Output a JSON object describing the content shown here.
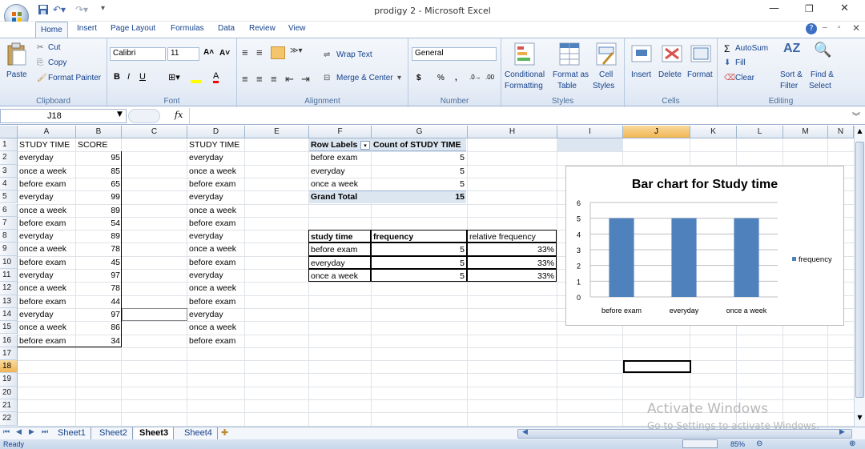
{
  "window": {
    "title": "prodigy 2 - Microsoft Excel"
  },
  "tabs": [
    "Home",
    "Insert",
    "Page Layout",
    "Formulas",
    "Data",
    "Review",
    "View"
  ],
  "ribbon": {
    "clipboard": {
      "paste": "Paste",
      "cut": "Cut",
      "copy": "Copy",
      "format_painter": "Format Painter",
      "label": "Clipboard"
    },
    "font": {
      "name": "Calibri",
      "size": "11",
      "label": "Font"
    },
    "alignment": {
      "wrap": "Wrap Text",
      "merge": "Merge & Center",
      "label": "Alignment"
    },
    "number": {
      "format": "General",
      "dollar": "$",
      "percent": "%",
      "comma": ",",
      "label": "Number"
    },
    "styles": {
      "conditional_1": "Conditional",
      "conditional_2": "Formatting",
      "format_table_1": "Format as",
      "format_table_2": "Table",
      "cell_styles_1": "Cell",
      "cell_styles_2": "Styles",
      "label": "Styles"
    },
    "cells": {
      "insert": "Insert",
      "delete": "Delete",
      "format": "Format",
      "label": "Cells"
    },
    "editing": {
      "autosum": "AutoSum",
      "fill": "Fill",
      "clear": "Clear",
      "sort_1": "Sort &",
      "sort_2": "Filter",
      "find_1": "Find &",
      "find_2": "Select",
      "label": "Editing"
    }
  },
  "formula_bar": {
    "cell_ref": "J18",
    "fx": "fx",
    "value": ""
  },
  "columns": [
    "A",
    "B",
    "C",
    "D",
    "E",
    "F",
    "G",
    "H",
    "I",
    "J",
    "K",
    "L",
    "M",
    "N"
  ],
  "rows": [
    "1",
    "2",
    "3",
    "4",
    "5",
    "6",
    "7",
    "8",
    "9",
    "10",
    "11",
    "12",
    "13",
    "14",
    "15",
    "16",
    "17",
    "18",
    "19",
    "20",
    "21",
    "22"
  ],
  "colA": [
    "STUDY TIME",
    "everyday",
    "once a week",
    "before exam",
    "everyday",
    "once a week",
    "before exam",
    "everyday",
    "once a week",
    "before exam",
    "everyday",
    "once a week",
    "before exam",
    "everyday",
    "once a week",
    "before exam"
  ],
  "colB": [
    "SCORE",
    "95",
    "85",
    "65",
    "99",
    "89",
    "54",
    "89",
    "78",
    "45",
    "97",
    "78",
    "44",
    "97",
    "86",
    "34"
  ],
  "colD": [
    "STUDY TIME",
    "everyday",
    "once a week",
    "before exam",
    "everyday",
    "once a week",
    "before exam",
    "everyday",
    "once a week",
    "before exam",
    "everyday",
    "once a week",
    "before exam",
    "everyday",
    "once a week",
    "before exam"
  ],
  "pivot": {
    "header_labels": "Row Labels",
    "header_count": "Count of STUDY TIME",
    "rows": [
      [
        "before exam",
        "5"
      ],
      [
        "everyday",
        "5"
      ],
      [
        "once a week",
        "5"
      ]
    ],
    "total_label": "Grand Total",
    "total_value": "15"
  },
  "freq_table": {
    "headers": [
      "study time",
      "frequency",
      "relative frequency"
    ],
    "rows": [
      [
        "before exam",
        "5",
        "33%"
      ],
      [
        "everyday",
        "5",
        "33%"
      ],
      [
        "once a week",
        "5",
        "33%"
      ]
    ]
  },
  "chart_data": {
    "type": "bar",
    "title": "Bar chart for Study time",
    "categories": [
      "before exam",
      "everyday",
      "once a week"
    ],
    "series": [
      {
        "name": "frequency",
        "values": [
          5,
          5,
          5
        ]
      }
    ],
    "ylim": [
      0,
      6
    ],
    "yticks": [
      "0",
      "1",
      "2",
      "3",
      "4",
      "5",
      "6"
    ],
    "grid": true,
    "legend": "right",
    "color": "#4f81bd"
  },
  "sheets": [
    "Sheet1",
    "Sheet2",
    "Sheet3",
    "Sheet4"
  ],
  "active_sheet": "Sheet3",
  "status": {
    "ready": "Ready",
    "zoom": "85%"
  },
  "watermark": {
    "line1": "Activate Windows",
    "line2": "Go to Settings to activate Windows."
  }
}
